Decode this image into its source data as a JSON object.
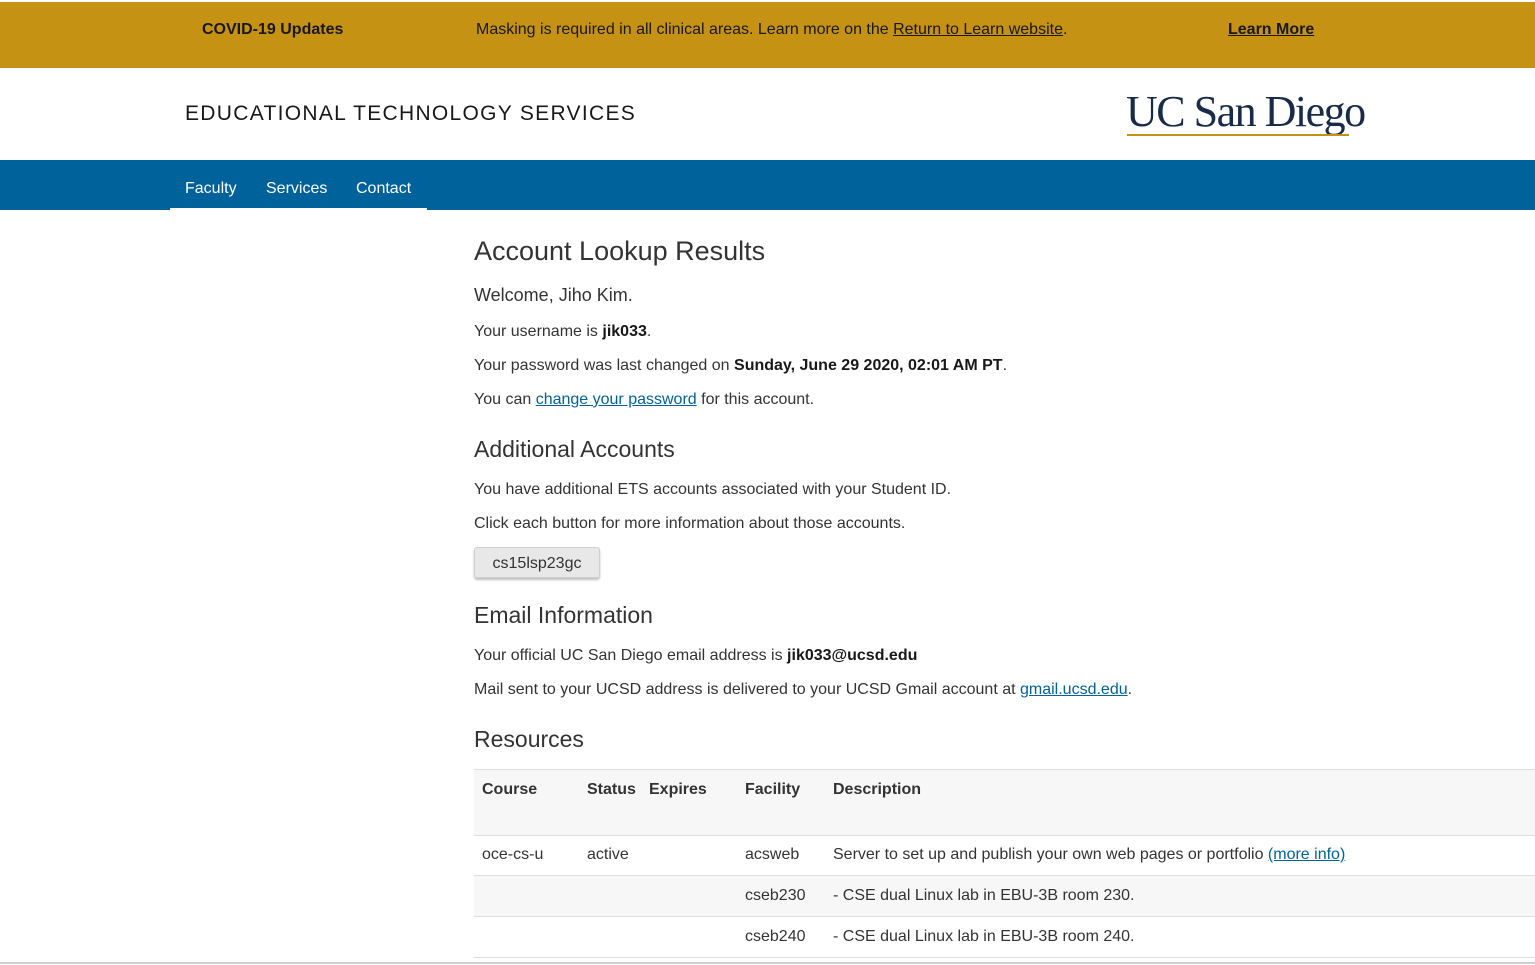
{
  "banner": {
    "title": "COVID-19 Updates",
    "message_prefix": "Masking is required in all clinical areas. Learn more on the ",
    "message_link": "Return to Learn website",
    "message_suffix": ".",
    "learn_more": "Learn More",
    "color": "#c69214"
  },
  "header": {
    "site_title": "EDUCATIONAL TECHNOLOGY SERVICES",
    "logo_text": "UC San Diego"
  },
  "nav": {
    "items": [
      "Faculty",
      "Services",
      "Contact"
    ],
    "color": "#00629b"
  },
  "main": {
    "title": "Account Lookup Results",
    "welcome": "Welcome, Jiho Kim.",
    "username_prefix": "Your username is ",
    "username": "jik033",
    "username_suffix": ".",
    "password_prefix": "Your password was last changed on ",
    "password_date": "Sunday, June 29 2020, 02:01 AM PT",
    "password_suffix": ".",
    "change_prefix": "You can ",
    "change_link": "change your password",
    "change_suffix": " for this account.",
    "additional_title": "Additional Accounts",
    "additional_p1": "You have additional ETS accounts associated with your Student ID.",
    "additional_p2": "Click each button for more information about those accounts.",
    "account_button": "cs15lsp23gc",
    "email_title": "Email Information",
    "email_prefix": "Your official UC San Diego email address is ",
    "email": "jik033@ucsd.edu",
    "mail_prefix": "Mail sent to your UCSD address is delivered to your UCSD Gmail account at ",
    "mail_link": "gmail.ucsd.edu",
    "mail_suffix": ".",
    "resources_title": "Resources"
  },
  "table": {
    "headers": [
      "Course",
      "Status",
      "Expires",
      "Facility",
      "Description"
    ],
    "rows": [
      {
        "course": "oce-cs-u",
        "status": "active",
        "expires": "",
        "facility": "acsweb",
        "description": "Server to set up and publish your own web pages or portfolio ",
        "link": "(more info)"
      },
      {
        "course": "",
        "status": "",
        "expires": "",
        "facility": "cseb230",
        "description": "- CSE dual Linux lab in EBU-3B room 230.",
        "link": ""
      },
      {
        "course": "",
        "status": "",
        "expires": "",
        "facility": "cseb240",
        "description": "- CSE dual Linux lab in EBU-3B room 240.",
        "link": ""
      }
    ]
  },
  "colors": {
    "link": "#00629b",
    "logo_navy": "#182b49",
    "gold": "#c69214"
  }
}
